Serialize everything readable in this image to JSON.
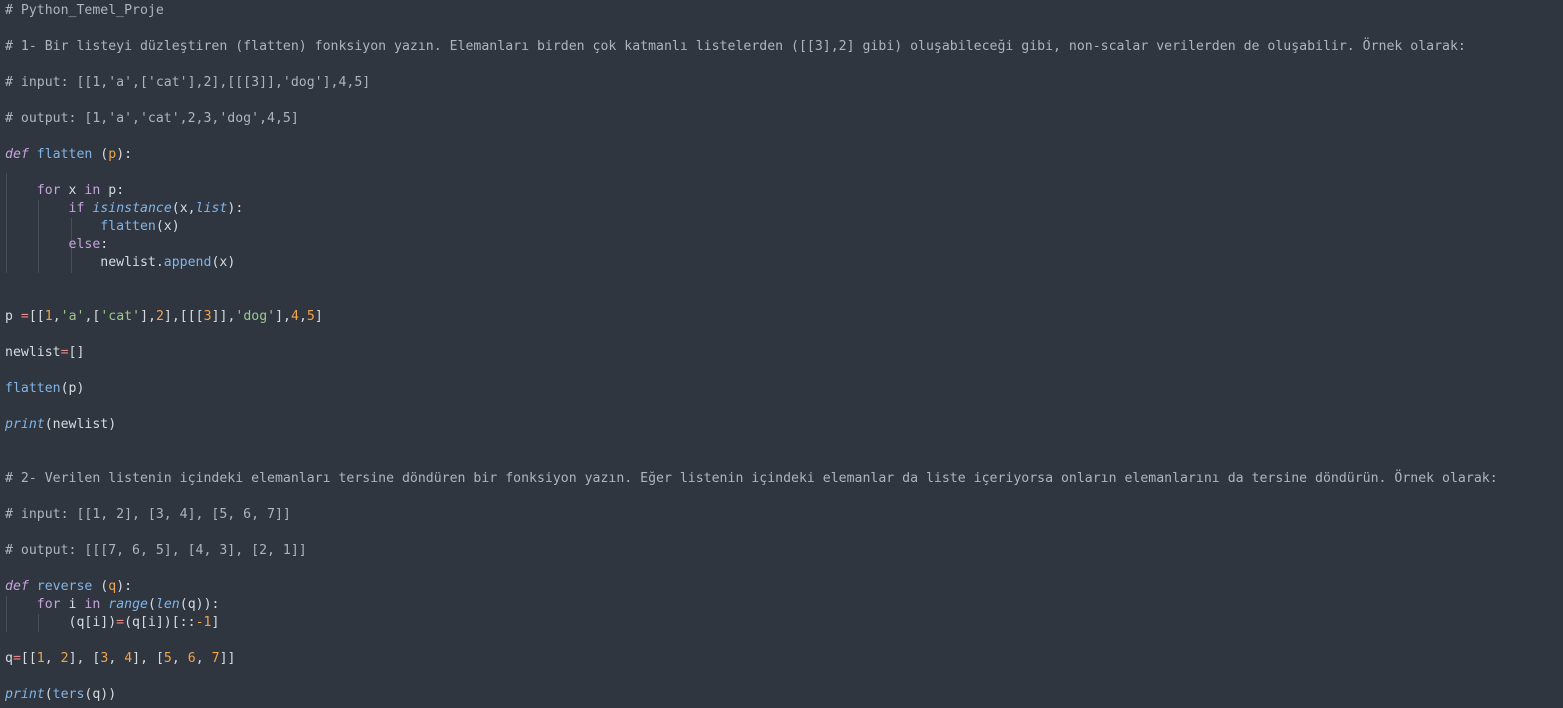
{
  "editor": {
    "colors": {
      "background": "#2f3640",
      "comment": "#aeb4ba",
      "keyword": "#c7a2dd",
      "function": "#82b4e6",
      "number": "#f0a54a",
      "string": "#9dc88d",
      "operator": "#e98a8a",
      "text": "#d6dbe0"
    },
    "lines": [
      [
        {
          "t": "# Python_Temel_Proje",
          "c": "c"
        }
      ],
      [
        {
          "t": "# 1- Bir listeyi düzleştiren (flatten) fonksiyon yazın. Elemanları birden çok katmanlı listelerden ([[3],2] gibi) oluşabileceği gibi, non-scalar verilerden de oluşabilir. Örnek olarak:",
          "c": "c"
        }
      ],
      [
        {
          "t": "# input: [[1,'a',['cat'],2],[[[3]],'dog'],4,5]",
          "c": "c"
        }
      ],
      [
        {
          "t": "# output: [1,'a','cat',2,3,'dog',4,5]",
          "c": "c"
        }
      ],
      [
        {
          "t": "def",
          "c": "kwi"
        },
        {
          "t": " ",
          "c": "tx"
        },
        {
          "t": "flatten",
          "c": "fn"
        },
        {
          "t": " (",
          "c": "tx"
        },
        {
          "t": "p",
          "c": "pa"
        },
        {
          "t": "):",
          "c": "tx"
        }
      ],
      [
        {
          "t": "    ",
          "c": "tx"
        },
        {
          "t": "for",
          "c": "kw"
        },
        {
          "t": " x ",
          "c": "tx"
        },
        {
          "t": "in",
          "c": "kw"
        },
        {
          "t": " p:",
          "c": "tx"
        }
      ],
      [
        {
          "t": "        ",
          "c": "tx"
        },
        {
          "t": "if",
          "c": "kw"
        },
        {
          "t": " ",
          "c": "tx"
        },
        {
          "t": "isinstance",
          "c": "bi"
        },
        {
          "t": "(x,",
          "c": "tx"
        },
        {
          "t": "list",
          "c": "bi"
        },
        {
          "t": "):",
          "c": "tx"
        }
      ],
      [
        {
          "t": "            ",
          "c": "tx"
        },
        {
          "t": "flatten",
          "c": "fn"
        },
        {
          "t": "(x)",
          "c": "tx"
        }
      ],
      [
        {
          "t": "        ",
          "c": "tx"
        },
        {
          "t": "else",
          "c": "kw"
        },
        {
          "t": ":",
          "c": "tx"
        }
      ],
      [
        {
          "t": "            newlist.",
          "c": "tx"
        },
        {
          "t": "append",
          "c": "fn"
        },
        {
          "t": "(x)",
          "c": "tx"
        }
      ],
      [
        {
          "t": "p ",
          "c": "tx"
        },
        {
          "t": "=",
          "c": "op"
        },
        {
          "t": "[[",
          "c": "tx"
        },
        {
          "t": "1",
          "c": "nu"
        },
        {
          "t": ",",
          "c": "tx"
        },
        {
          "t": "'a'",
          "c": "st"
        },
        {
          "t": ",[",
          "c": "tx"
        },
        {
          "t": "'cat'",
          "c": "st"
        },
        {
          "t": "],",
          "c": "tx"
        },
        {
          "t": "2",
          "c": "nu"
        },
        {
          "t": "],[[[",
          "c": "tx"
        },
        {
          "t": "3",
          "c": "nu"
        },
        {
          "t": "]],",
          "c": "tx"
        },
        {
          "t": "'dog'",
          "c": "st"
        },
        {
          "t": "],",
          "c": "tx"
        },
        {
          "t": "4",
          "c": "nu"
        },
        {
          "t": ",",
          "c": "tx"
        },
        {
          "t": "5",
          "c": "nu"
        },
        {
          "t": "]",
          "c": "tx"
        }
      ],
      [
        {
          "t": "newlist",
          "c": "tx"
        },
        {
          "t": "=",
          "c": "op"
        },
        {
          "t": "[]",
          "c": "tx"
        }
      ],
      [
        {
          "t": "flatten",
          "c": "fn"
        },
        {
          "t": "(p)",
          "c": "tx"
        }
      ],
      [
        {
          "t": "print",
          "c": "bi"
        },
        {
          "t": "(newlist)",
          "c": "tx"
        }
      ],
      [
        {
          "t": "# 2- Verilen listenin içindeki elemanları tersine döndüren bir fonksiyon yazın. Eğer listenin içindeki elemanlar da liste içeriyorsa onların elemanlarını da tersine döndürün. Örnek olarak:",
          "c": "c"
        }
      ],
      [
        {
          "t": "# input: [[1, 2], [3, 4], [5, 6, 7]]",
          "c": "c"
        }
      ],
      [
        {
          "t": "# output: [[[7, 6, 5], [4, 3], [2, 1]]",
          "c": "c"
        }
      ],
      [
        {
          "t": "def",
          "c": "kwi"
        },
        {
          "t": " ",
          "c": "tx"
        },
        {
          "t": "reverse",
          "c": "fn"
        },
        {
          "t": " (",
          "c": "tx"
        },
        {
          "t": "q",
          "c": "pa"
        },
        {
          "t": "):",
          "c": "tx"
        }
      ],
      [
        {
          "t": "    ",
          "c": "tx"
        },
        {
          "t": "for",
          "c": "kw"
        },
        {
          "t": " i ",
          "c": "tx"
        },
        {
          "t": "in",
          "c": "kw"
        },
        {
          "t": " ",
          "c": "tx"
        },
        {
          "t": "range",
          "c": "bi"
        },
        {
          "t": "(",
          "c": "tx"
        },
        {
          "t": "len",
          "c": "bi"
        },
        {
          "t": "(q)):",
          "c": "tx"
        }
      ],
      [
        {
          "t": "        (q[i])",
          "c": "tx"
        },
        {
          "t": "=",
          "c": "op"
        },
        {
          "t": "(q[i])[::",
          "c": "tx"
        },
        {
          "t": "-1",
          "c": "nu"
        },
        {
          "t": "]",
          "c": "tx"
        }
      ],
      [
        {
          "t": "q",
          "c": "tx"
        },
        {
          "t": "=",
          "c": "op"
        },
        {
          "t": "[[",
          "c": "tx"
        },
        {
          "t": "1",
          "c": "nu"
        },
        {
          "t": ", ",
          "c": "tx"
        },
        {
          "t": "2",
          "c": "nu"
        },
        {
          "t": "], [",
          "c": "tx"
        },
        {
          "t": "3",
          "c": "nu"
        },
        {
          "t": ", ",
          "c": "tx"
        },
        {
          "t": "4",
          "c": "nu"
        },
        {
          "t": "], [",
          "c": "tx"
        },
        {
          "t": "5",
          "c": "nu"
        },
        {
          "t": ", ",
          "c": "tx"
        },
        {
          "t": "6",
          "c": "nu"
        },
        {
          "t": ", ",
          "c": "tx"
        },
        {
          "t": "7",
          "c": "nu"
        },
        {
          "t": "]]",
          "c": "tx"
        }
      ],
      [
        {
          "t": "print",
          "c": "bi"
        },
        {
          "t": "(",
          "c": "tx"
        },
        {
          "t": "ters",
          "c": "fn"
        },
        {
          "t": "(q))",
          "c": "tx"
        }
      ]
    ]
  }
}
